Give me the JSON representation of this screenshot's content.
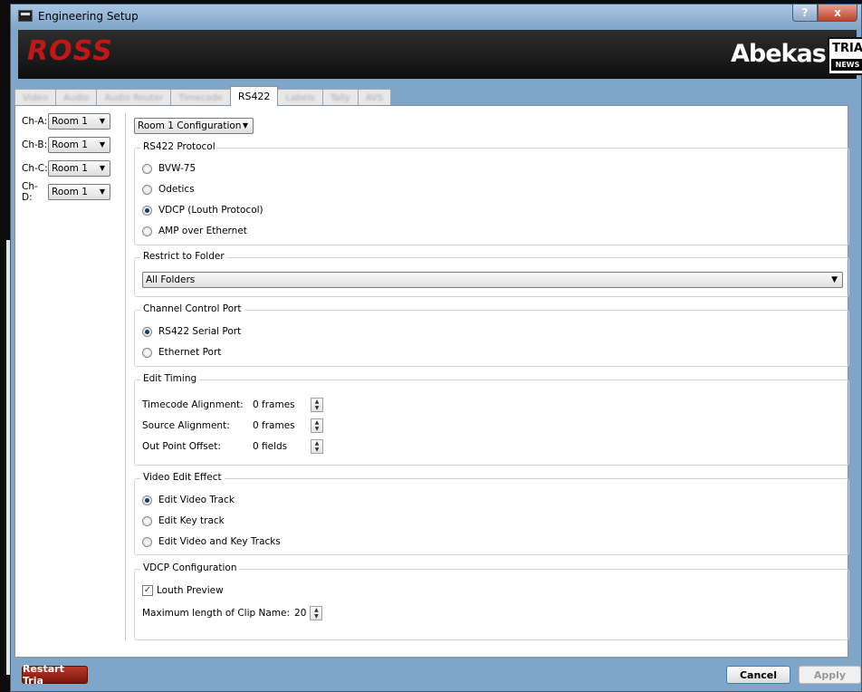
{
  "window": {
    "title": "Engineering Setup",
    "help_label": "?",
    "close_label": "x"
  },
  "banner": {
    "ross": "ROSS",
    "abekas": "Abekas",
    "tria": "TRIA",
    "news": "NEWS"
  },
  "tabs": [
    {
      "label": "Video",
      "active": false
    },
    {
      "label": "Audio",
      "active": false
    },
    {
      "label": "Audio Router",
      "active": false
    },
    {
      "label": "Timecode",
      "active": false
    },
    {
      "label": "RS422",
      "active": true
    },
    {
      "label": "Labels",
      "active": false
    },
    {
      "label": "Tally",
      "active": false
    },
    {
      "label": "AVS",
      "active": false
    }
  ],
  "channels": [
    {
      "label": "Ch-A:",
      "value": "Room 1"
    },
    {
      "label": "Ch-B:",
      "value": "Room 1"
    },
    {
      "label": "Ch-C:",
      "value": "Room 1"
    },
    {
      "label": "Ch-D:",
      "value": "Room 1"
    }
  ],
  "config_select": "Room 1 Configuration",
  "rs422_protocol": {
    "title": "RS422 Protocol",
    "options": [
      "BVW-75",
      "Odetics",
      "VDCP (Louth Protocol)",
      "AMP over Ethernet"
    ],
    "selected": "VDCP (Louth Protocol)"
  },
  "restrict_folder": {
    "title": "Restrict to Folder",
    "value": "All Folders"
  },
  "channel_control_port": {
    "title": "Channel Control Port",
    "options": [
      "RS422 Serial Port",
      "Ethernet Port"
    ],
    "selected": "RS422 Serial Port"
  },
  "edit_timing": {
    "title": "Edit Timing",
    "rows": [
      {
        "label": "Timecode Alignment:",
        "value": "0 frames"
      },
      {
        "label": "Source Alignment:",
        "value": "0 frames"
      },
      {
        "label": "Out Point Offset:",
        "value": "0 fields"
      }
    ]
  },
  "video_edit_effect": {
    "title": "Video Edit Effect",
    "options": [
      "Edit Video Track",
      "Edit Key track",
      "Edit Video and Key Tracks"
    ],
    "selected": "Edit Video Track"
  },
  "vdcp_configuration": {
    "title": "VDCP Configuration",
    "louth_preview_label": "Louth Preview",
    "louth_preview_checked": true,
    "clip_name_label": "Maximum length of Clip Name:",
    "clip_name_value": "20"
  },
  "buttons": {
    "restart": "Restart Tria",
    "cancel": "Cancel",
    "apply": "Apply"
  },
  "colors": {
    "accent_red": "#c01818",
    "title_bar": "#7fa5c8"
  }
}
